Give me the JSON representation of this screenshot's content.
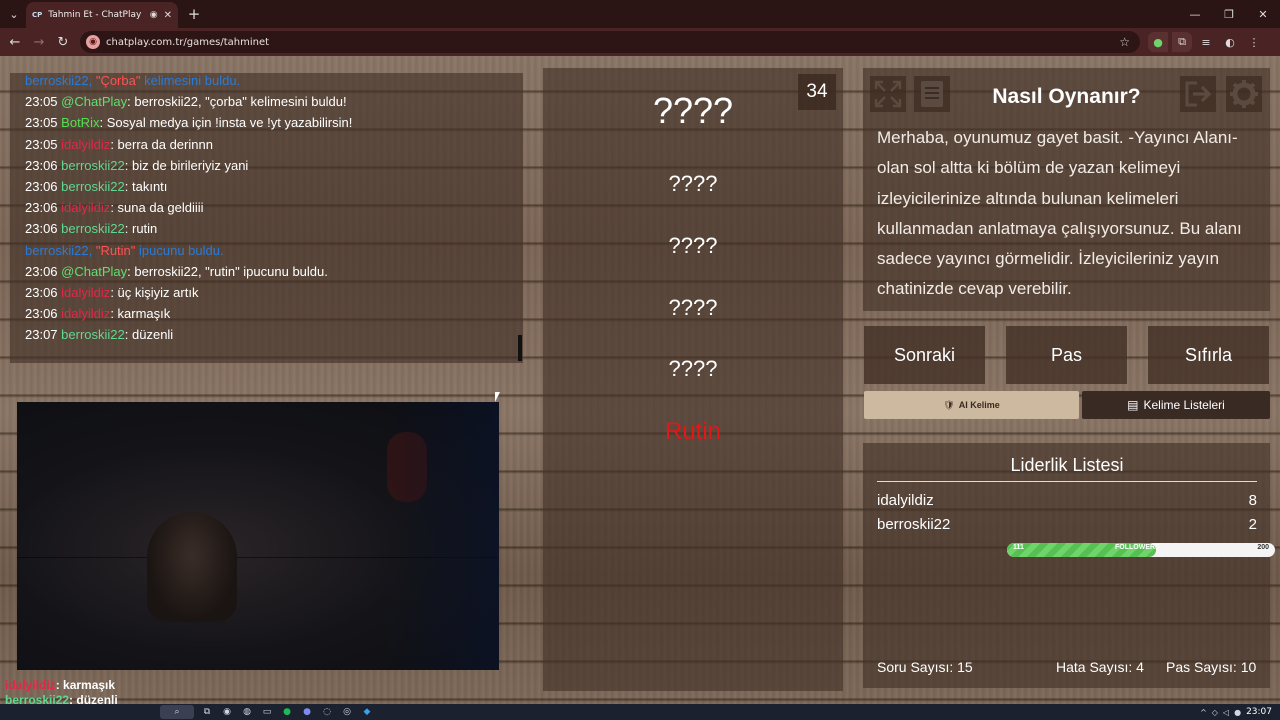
{
  "browser": {
    "tab_favicon": "CP",
    "tab_title": "Tahmin Et - ChatPlay",
    "url": "chatplay.com.tr/games/tahminet",
    "icons": [
      "tab-list-icon",
      "record-icon",
      "close-icon",
      "new-tab-icon",
      "minimize-icon",
      "restore-icon",
      "window-close-icon",
      "back-icon",
      "forward-icon",
      "reload-icon",
      "site-info-icon",
      "bookmark-star-icon",
      "extension-icon",
      "puzzle-icon",
      "media-icon",
      "profile-icon",
      "menu-icon"
    ]
  },
  "chat": {
    "lines": [
      {
        "time": "",
        "user": "berroskii22,",
        "text": "kelimesini buldu.",
        "quote": "\"Çorba\"",
        "system": true
      },
      {
        "time": "23:05",
        "user": "@ChatPlay",
        "user_class": "u-cp",
        "text": "berroskii22, \"çorba\" kelimesini buldu!"
      },
      {
        "time": "23:05",
        "user": "BotRix",
        "user_class": "u-bot",
        "text": "Sosyal medya için !insta ve !yt yazabilirsin!"
      },
      {
        "time": "23:05",
        "user": "idalyildiz",
        "user_class": "u-ida",
        "text": "berra da derinnn"
      },
      {
        "time": "23:06",
        "user": "berroskii22",
        "user_class": "u-ber",
        "text": "biz de birileriyiz yani"
      },
      {
        "time": "23:06",
        "user": "berroskii22",
        "user_class": "u-ber",
        "text": "takıntı"
      },
      {
        "time": "23:06",
        "user": "idalyildiz",
        "user_class": "u-ida",
        "text": "suna da geldiiii"
      },
      {
        "time": "23:06",
        "user": "berroskii22",
        "user_class": "u-ber",
        "text": "rutin"
      },
      {
        "time": "",
        "user": "berroskii22,",
        "text": "ipucunu buldu.",
        "quote": "\"Rutin\"",
        "system": true
      },
      {
        "time": "23:06",
        "user": "@ChatPlay",
        "user_class": "u-cp",
        "text": "berroskii22, \"rutin\" ipucunu buldu."
      },
      {
        "time": "23:06",
        "user": "idalyildiz",
        "user_class": "u-ida",
        "text": "üç kişiyiz artık"
      },
      {
        "time": "23:06",
        "user": "idalyildiz",
        "user_class": "u-ida",
        "text": "karmaşık"
      },
      {
        "time": "23:07",
        "user": "berroskii22",
        "user_class": "u-ber",
        "text": "düzenli"
      }
    ]
  },
  "game": {
    "timer": "34",
    "words": [
      "????",
      "????",
      "????",
      "????",
      "????",
      "Rutin"
    ],
    "highlight_color": "#e01818"
  },
  "how": {
    "title": "Nasıl Oynanır?",
    "text": "Merhaba, oyunumuz gayet basit. -Yayıncı Alanı- olan sol altta ki bölüm de yazan kelimeyi izleyicilerinize altında bulunan kelimeleri kullanmadan anlatmaya çalışıyorsunuz. Bu alanı sadece yayıncı görmelidir. İzleyicileriniz yayın chatinizde cevap verebilir.",
    "icons": [
      "fullscreen-icon",
      "book-icon",
      "exit-icon",
      "gear-icon"
    ]
  },
  "buttons": {
    "next": "Sonraki",
    "pass": "Pas",
    "reset": "Sıfırla",
    "ai": "AI Kelime",
    "lists": "Kelime Listeleri"
  },
  "leaderboard": {
    "title": "Liderlik Listesi",
    "rows": [
      {
        "name": "idalyildiz",
        "score": "8"
      },
      {
        "name": "berroskii22",
        "score": "2"
      }
    ]
  },
  "followers": {
    "current": "111",
    "label": "FOLLOWERS",
    "goal": "200",
    "progress": 0.555,
    "color": "#56c052"
  },
  "stats": {
    "questions": "Soru Sayısı: 15",
    "errors": "Hata Sayısı: 4",
    "passes": "Pas Sayısı: 10"
  },
  "overlay": {
    "rows": [
      {
        "user": "idalyildiz",
        "text": ": karmaşık"
      },
      {
        "user": "berroskii22",
        "text": ": düzenli"
      }
    ]
  },
  "taskbar": {
    "clock": "23:07",
    "icons": [
      "search-icon",
      "task-view-icon",
      "edge-icon",
      "chrome-icon",
      "folder-icon",
      "spotify-icon",
      "discord-icon",
      "obs-icon",
      "steam-icon",
      "vscode-icon"
    ]
  }
}
